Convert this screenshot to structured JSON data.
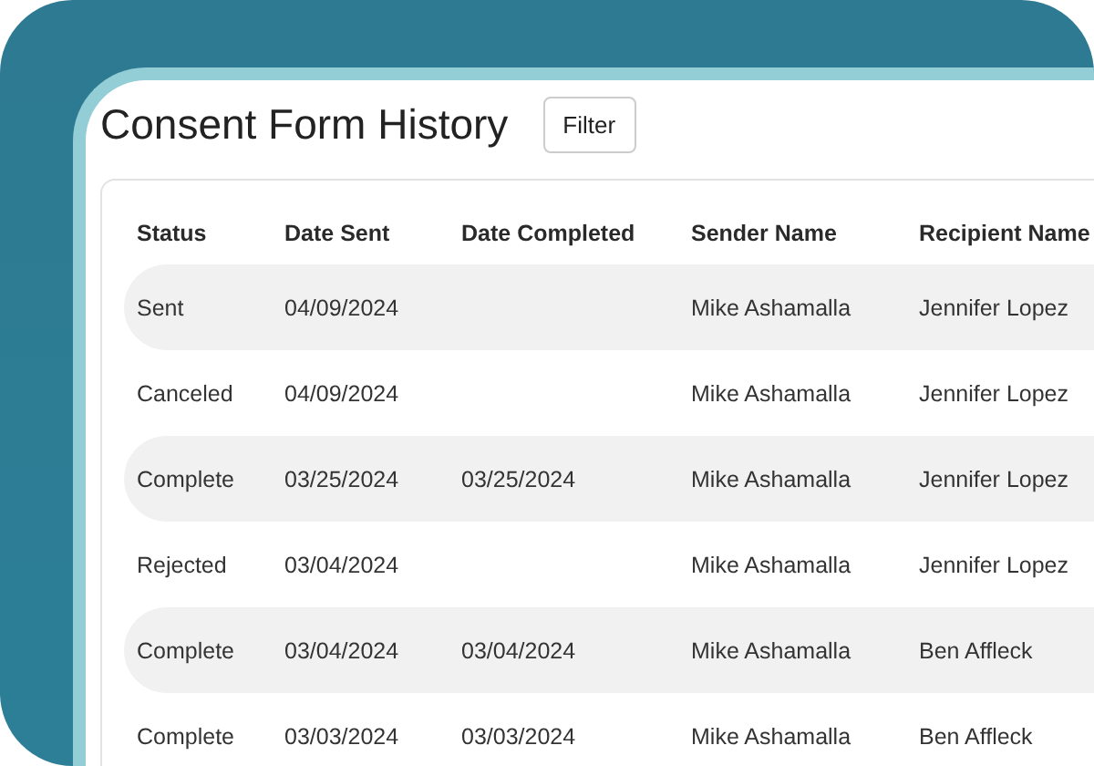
{
  "title": "Consent Form History",
  "filter_button": "Filter",
  "table": {
    "columns": [
      "Status",
      "Date Sent",
      "Date Completed",
      "Sender Name",
      "Recipient Name"
    ],
    "rows": [
      [
        "Sent",
        "04/09/2024",
        "",
        "Mike Ashamalla",
        "Jennifer Lopez"
      ],
      [
        "Canceled",
        "04/09/2024",
        "",
        "Mike Ashamalla",
        "Jennifer Lopez"
      ],
      [
        "Complete",
        "03/25/2024",
        "03/25/2024",
        "Mike Ashamalla",
        "Jennifer Lopez"
      ],
      [
        "Rejected",
        "03/04/2024",
        "",
        "Mike Ashamalla",
        "Jennifer Lopez"
      ],
      [
        "Complete",
        "03/04/2024",
        "03/04/2024",
        "Mike Ashamalla",
        "Ben Affleck"
      ],
      [
        "Complete",
        "03/03/2024",
        "03/03/2024",
        "Mike Ashamalla",
        "Ben Affleck"
      ]
    ]
  }
}
